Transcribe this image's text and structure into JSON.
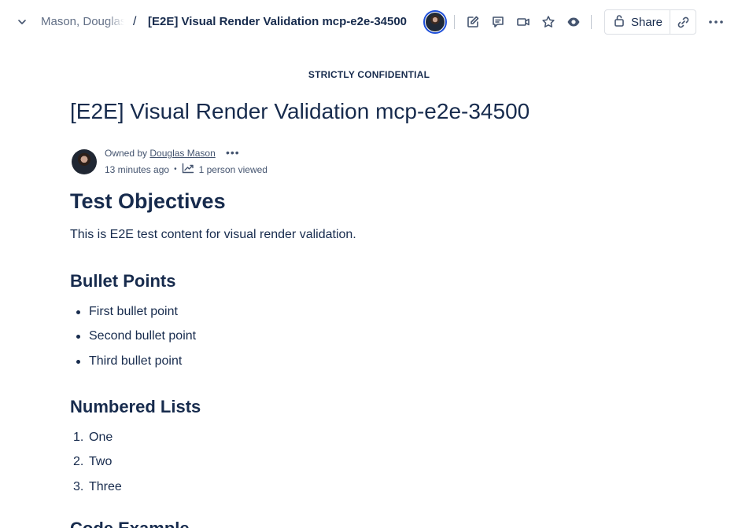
{
  "header": {
    "breadcrumb_parent": "Mason, Douglas",
    "breadcrumb_separator": "/",
    "page_title": "[E2E] Visual Render Validation mcp-e2e-34500",
    "share_label": "Share",
    "icons": [
      "chevron-down-icon",
      "avatar",
      "edit-icon",
      "comment-icon",
      "video-icon",
      "star-icon",
      "watch-icon",
      "lock-icon",
      "link-icon",
      "more-icon"
    ],
    "accent_color": "#1d4ed8"
  },
  "document": {
    "classification": "STRICTLY CONFIDENTIAL",
    "title": "[E2E] Visual Render Validation mcp-e2e-34500",
    "byline": {
      "owned_prefix": "Owned by",
      "owner": "Douglas Mason",
      "more": "•••",
      "updated": "13 minutes ago",
      "separator": "•",
      "views": "1 person viewed"
    },
    "sections": {
      "objectives_heading": "Test Objectives",
      "objectives_text": "This is E2E test content for visual render validation.",
      "bullets_heading": "Bullet Points",
      "bullets": [
        "First bullet point",
        "Second bullet point",
        "Third bullet point"
      ],
      "numbered_heading": "Numbered Lists",
      "numbered": [
        "One",
        "Two",
        "Three"
      ],
      "numbered_markers": [
        "1.",
        "2.",
        "3."
      ],
      "code_heading": "Code Example"
    }
  }
}
